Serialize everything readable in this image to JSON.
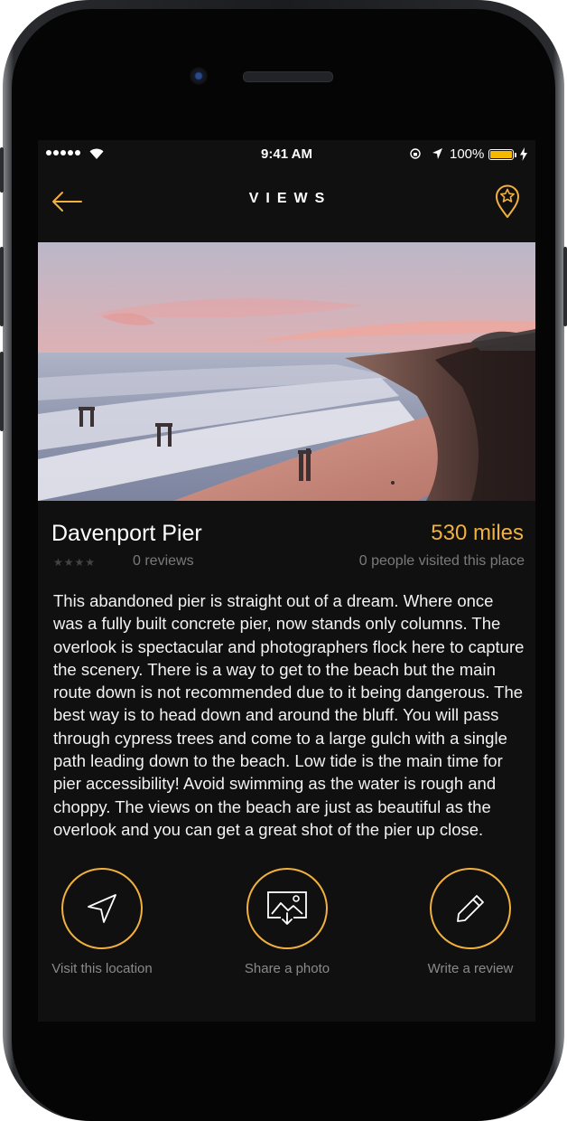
{
  "status_bar": {
    "time": "9:41 AM",
    "battery_percent": "100%",
    "battery_color": "#f5b900"
  },
  "nav": {
    "title": "VIEWS",
    "back_icon": "arrow-left-icon",
    "favorite_icon": "star-pin-icon",
    "accent_color": "#f2b03d"
  },
  "place": {
    "name": "Davenport Pier",
    "distance": "530 miles",
    "rating_stars": 0,
    "stars_text": "★★★★",
    "reviews": "0 reviews",
    "visited": "0 people visited this place",
    "description": "This abandoned pier is straight out of a dream. Where once was a fully built concrete pier, now stands only columns. The overlook is spectacular and photographers flock here to capture the scenery. There is a way to get to the beach but the main route down is not recommended due to it being dangerous. The best way is to head down and around the bluff. You will pass through cypress trees and come to a large gulch with a single path leading down to the beach. Low tide is the main time for pier accessibility! Avoid swimming as the water is rough and choppy. The views on the beach are just as beautiful as the overlook and you can get a great shot of the pier up close."
  },
  "actions": [
    {
      "label": "Visit this location",
      "icon": "navigation-arrow-icon"
    },
    {
      "label": "Share a photo",
      "icon": "photo-upload-icon"
    },
    {
      "label": "Write a review",
      "icon": "pencil-icon"
    }
  ]
}
